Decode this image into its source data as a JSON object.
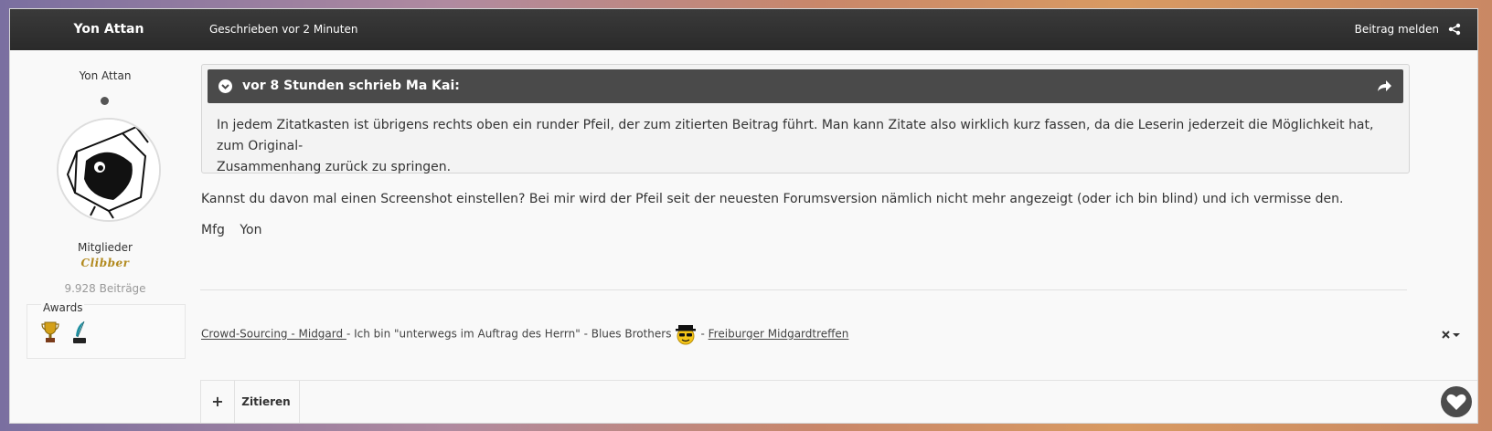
{
  "post": {
    "author": "Yon Attan",
    "timestamp": "Geschrieben vor 2 Minuten",
    "report_label": "Beitrag melden",
    "share_icon": "share-icon"
  },
  "sidebar": {
    "username": "Yon Attan",
    "group": "Mitglieder",
    "rank": "Clibber",
    "post_count": "9.928 Beiträge",
    "awards_title": "Awards",
    "awards": [
      "trophy-award-icon",
      "quill-award-icon"
    ]
  },
  "quote": {
    "citation": "vor 8 Stunden schrieb Ma Kai:",
    "line1": "In jedem Zitatkasten ist übrigens rechts oben ein runder Pfeil, der zum zitierten Beitrag führt. Man kann Zitate also wirklich kurz fassen, da die Leserin jederzeit die Möglichkeit hat, zum Original-",
    "line2": "Zusammenhang zurück zu springen."
  },
  "body": {
    "paragraph": "Kannst du davon mal einen Screenshot einstellen? Bei mir wird der Pfeil seit der neuesten Forumsversion nämlich nicht mehr angezeigt (oder ich bin blind) und ich vermisse den.",
    "greeting_1": "Mfg",
    "greeting_2": "Yon"
  },
  "signature": {
    "link1": "Crowd-Sourcing - Midgard ",
    "text": "- Ich bin \"unterwegs im Auftrag des Herrn\" - Blues Brothers",
    "sep": "-",
    "link2": "Freiburger Midgardtreffen"
  },
  "footer": {
    "multiquote": "+",
    "quote_label": "Zitieren"
  },
  "colors": {
    "header_bg": "#2f2f2f",
    "citation_bg": "#4a4a4a",
    "post_bg": "#f9f9f9"
  }
}
